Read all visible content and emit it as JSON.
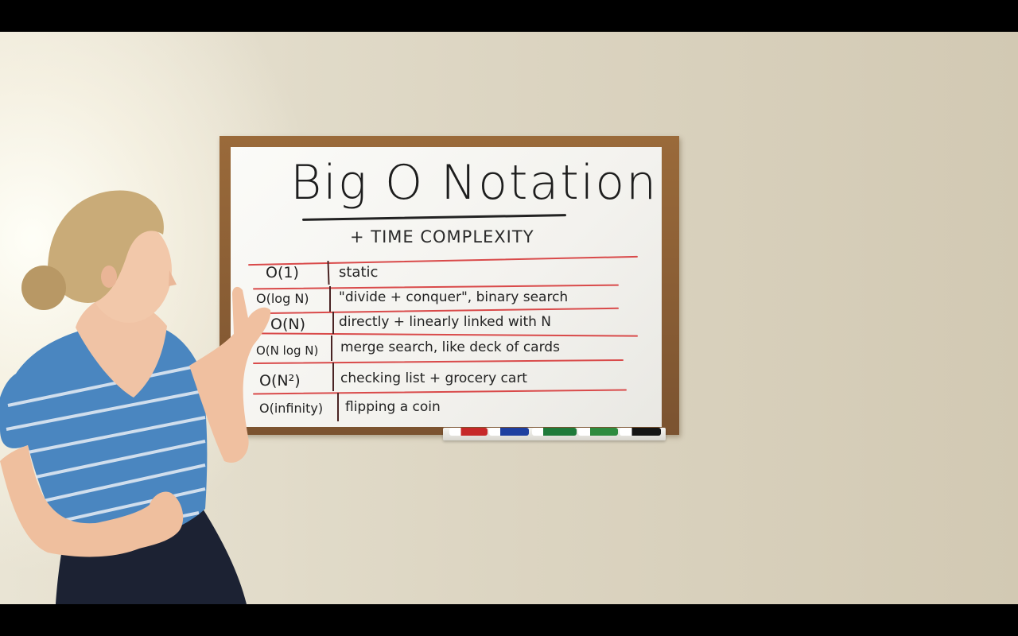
{
  "board": {
    "title": "Big O Notation",
    "subtitle": "+ TIME COMPLEXITY",
    "rows": [
      {
        "notation": "O(1)",
        "description": "static"
      },
      {
        "notation": "O(log N)",
        "description": "\"divide + conquer\", binary search"
      },
      {
        "notation": "O(N)",
        "description": "directly + linearly linked with N"
      },
      {
        "notation": "O(N log N)",
        "description": "merge search, like deck of cards"
      },
      {
        "notation": "O(N²)",
        "description": "checking list + grocery cart"
      },
      {
        "notation": "O(infinity)",
        "description": "flipping a coin"
      }
    ]
  },
  "colors": {
    "ink": "#222222",
    "red_ruling": "#d94a4a",
    "frame": "#8a5e34",
    "shirt": "#4a86c0",
    "wall": "#ddd6c3"
  }
}
